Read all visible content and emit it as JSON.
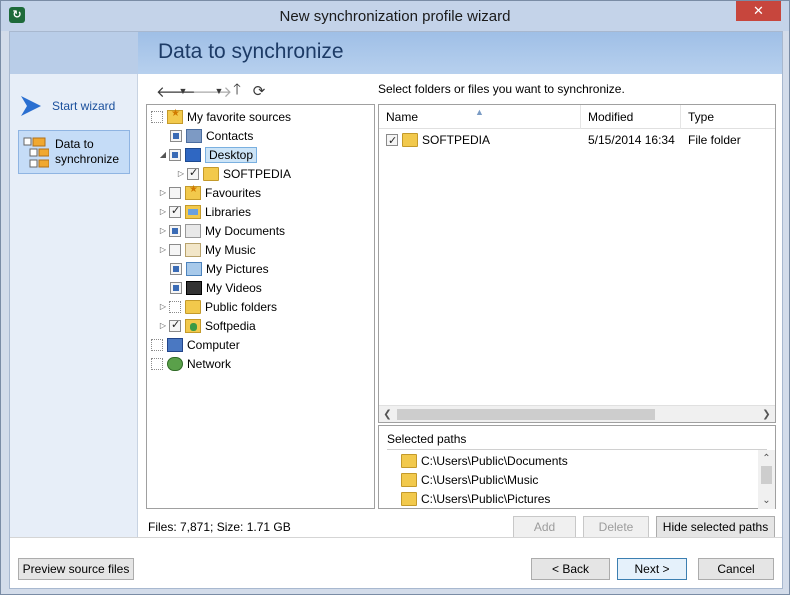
{
  "window": {
    "title": "New synchronization profile wizard",
    "close_glyph": "✕"
  },
  "header": {
    "title": "Data to synchronize"
  },
  "sidebar": {
    "items": [
      {
        "label": "Start wizard"
      },
      {
        "label": "Data to synchronize"
      }
    ]
  },
  "tree": {
    "items": [
      {
        "label": "My favorite sources"
      },
      {
        "label": "Contacts"
      },
      {
        "label": "Desktop"
      },
      {
        "label": "SOFTPEDIA"
      },
      {
        "label": "Favourites"
      },
      {
        "label": "Libraries"
      },
      {
        "label": "My Documents"
      },
      {
        "label": "My Music"
      },
      {
        "label": "My Pictures"
      },
      {
        "label": "My Videos"
      },
      {
        "label": "Public folders"
      },
      {
        "label": "Softpedia"
      },
      {
        "label": "Computer"
      },
      {
        "label": "Network"
      }
    ],
    "status": "Files: 7,871; Size: 1.71 GB"
  },
  "list": {
    "instruction": "Select folders or files you want to synchronize.",
    "columns": [
      "Name",
      "Modified",
      "Type"
    ],
    "rows": [
      {
        "name": "SOFTPEDIA",
        "modified": "5/15/2014 16:34",
        "type": "File folder"
      }
    ]
  },
  "paths": {
    "title": "Selected paths",
    "items": [
      "C:\\Users\\Public\\Documents",
      "C:\\Users\\Public\\Music",
      "C:\\Users\\Public\\Pictures"
    ]
  },
  "buttons": {
    "add": "Add",
    "delete": "Delete",
    "hide_paths": "Hide selected paths",
    "preview": "Preview source files",
    "back": "< Back",
    "next": "Next >",
    "cancel": "Cancel"
  },
  "colors": {
    "accent": "#1d3b66",
    "header_band": "#9fbfe6",
    "selection": "#c5dcf7"
  }
}
